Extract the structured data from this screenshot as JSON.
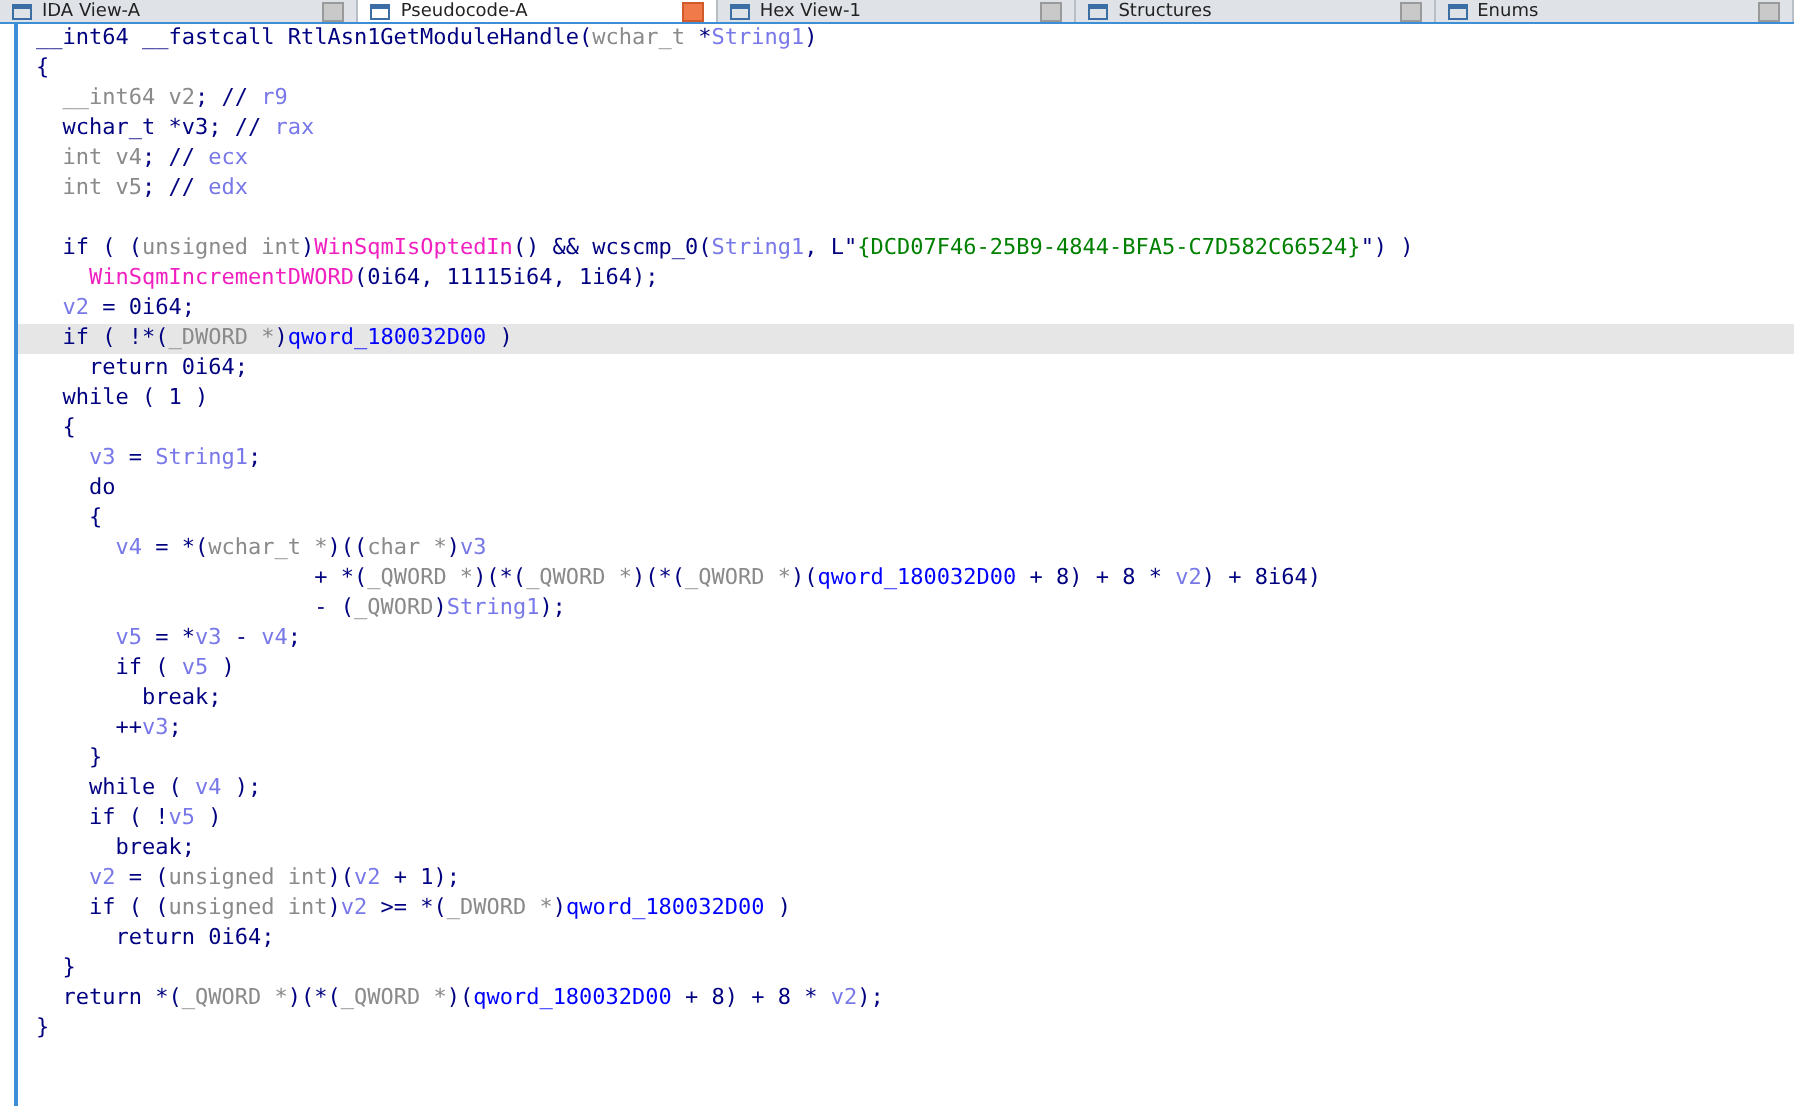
{
  "tabs": [
    {
      "label": "IDA View-A",
      "selected": false
    },
    {
      "label": "Pseudocode-A",
      "selected": true
    },
    {
      "label": "Hex View-1",
      "selected": false
    },
    {
      "label": "Structures",
      "selected": false
    },
    {
      "label": "Enums",
      "selected": false
    }
  ],
  "code": {
    "lines": [
      {
        "selected": false,
        "segments": [
          {
            "kind": "plain",
            "text": "__int64 __fastcall RtlAsn1GetModuleHandle("
          },
          {
            "kind": "type",
            "text": "wchar_t"
          },
          {
            "kind": "plain",
            "text": " *"
          },
          {
            "kind": "var",
            "text": "String1"
          },
          {
            "kind": "plain",
            "text": ")"
          }
        ]
      },
      {
        "selected": false,
        "segments": [
          {
            "kind": "plain",
            "text": "{"
          }
        ]
      },
      {
        "selected": false,
        "segments": [
          {
            "kind": "type",
            "text": "  __int64 v2"
          },
          {
            "kind": "plain",
            "text": "; // "
          },
          {
            "kind": "var",
            "text": "r9"
          }
        ]
      },
      {
        "selected": false,
        "segments": [
          {
            "kind": "plain",
            "text": "  wchar_t *v3; // "
          },
          {
            "kind": "var",
            "text": "rax"
          }
        ]
      },
      {
        "selected": false,
        "segments": [
          {
            "kind": "type",
            "text": "  int v4"
          },
          {
            "kind": "plain",
            "text": "; // "
          },
          {
            "kind": "var",
            "text": "ecx"
          }
        ]
      },
      {
        "selected": false,
        "segments": [
          {
            "kind": "type",
            "text": "  int v5"
          },
          {
            "kind": "plain",
            "text": "; // "
          },
          {
            "kind": "var",
            "text": "edx"
          }
        ]
      },
      {
        "selected": false
      },
      {
        "selected": false,
        "segments": [
          {
            "kind": "plain",
            "text": "  if ( ("
          },
          {
            "kind": "type",
            "text": "unsigned int"
          },
          {
            "kind": "plain",
            "text": ")"
          },
          {
            "kind": "func",
            "text": "WinSqmIsOptedIn"
          },
          {
            "kind": "plain",
            "text": "() && wcscmp_0("
          },
          {
            "kind": "var",
            "text": "String1"
          },
          {
            "kind": "plain",
            "text": ", L\""
          },
          {
            "kind": "string",
            "text": "{DCD07F46-25B9-4844-BFA5-C7D582C66524}"
          },
          {
            "kind": "plain",
            "text": "\") )"
          }
        ]
      },
      {
        "selected": false,
        "segments": [
          {
            "kind": "func",
            "text": "    WinSqmIncrementDWORD"
          },
          {
            "kind": "plain",
            "text": "(0i64, 11115i64, 1i64);"
          }
        ]
      },
      {
        "selected": false,
        "segments": [
          {
            "kind": "var",
            "text": "  v2"
          },
          {
            "kind": "plain",
            "text": " = 0i64;"
          }
        ]
      },
      {
        "selected": true,
        "segments": [
          {
            "kind": "plain",
            "text": "  if ( !*("
          },
          {
            "kind": "type",
            "text": "_DWORD *"
          },
          {
            "kind": "plain",
            "text": ")"
          },
          {
            "kind": "global",
            "text": "qword_180032D00"
          },
          {
            "kind": "plain",
            "text": " )"
          }
        ]
      },
      {
        "selected": false,
        "segments": [
          {
            "kind": "plain",
            "text": "    return 0i64;"
          }
        ]
      },
      {
        "selected": false,
        "segments": [
          {
            "kind": "plain",
            "text": "  while ( 1 )"
          }
        ]
      },
      {
        "selected": false,
        "segments": [
          {
            "kind": "plain",
            "text": "  {"
          }
        ]
      },
      {
        "selected": false,
        "segments": [
          {
            "kind": "var",
            "text": "    v3"
          },
          {
            "kind": "plain",
            "text": " = "
          },
          {
            "kind": "var",
            "text": "String1"
          },
          {
            "kind": "plain",
            "text": ";"
          }
        ]
      },
      {
        "selected": false,
        "segments": [
          {
            "kind": "plain",
            "text": "    do"
          }
        ]
      },
      {
        "selected": false,
        "segments": [
          {
            "kind": "plain",
            "text": "    {"
          }
        ]
      },
      {
        "selected": false,
        "segments": [
          {
            "kind": "var",
            "text": "      v4"
          },
          {
            "kind": "plain",
            "text": " = *("
          },
          {
            "kind": "type",
            "text": "wchar_t *"
          },
          {
            "kind": "plain",
            "text": ")(("
          },
          {
            "kind": "type",
            "text": "char *"
          },
          {
            "kind": "plain",
            "text": ")"
          },
          {
            "kind": "var",
            "text": "v3"
          }
        ]
      },
      {
        "selected": false,
        "segments": [
          {
            "kind": "plain",
            "text": "                     + *("
          },
          {
            "kind": "type",
            "text": "_QWORD *"
          },
          {
            "kind": "plain",
            "text": ")(*("
          },
          {
            "kind": "type",
            "text": "_QWORD *"
          },
          {
            "kind": "plain",
            "text": ")(*("
          },
          {
            "kind": "type",
            "text": "_QWORD *"
          },
          {
            "kind": "plain",
            "text": ")("
          },
          {
            "kind": "global",
            "text": "qword_180032D00"
          },
          {
            "kind": "plain",
            "text": " + 8) + 8 * "
          },
          {
            "kind": "var",
            "text": "v2"
          },
          {
            "kind": "plain",
            "text": ") + 8i64)"
          }
        ]
      },
      {
        "selected": false,
        "segments": [
          {
            "kind": "plain",
            "text": "                     - ("
          },
          {
            "kind": "type",
            "text": "_QWORD"
          },
          {
            "kind": "plain",
            "text": ")"
          },
          {
            "kind": "var",
            "text": "String1"
          },
          {
            "kind": "plain",
            "text": ");"
          }
        ]
      },
      {
        "selected": false,
        "segments": [
          {
            "kind": "var",
            "text": "      v5"
          },
          {
            "kind": "plain",
            "text": " = *"
          },
          {
            "kind": "var",
            "text": "v3"
          },
          {
            "kind": "plain",
            "text": " - "
          },
          {
            "kind": "var",
            "text": "v4"
          },
          {
            "kind": "plain",
            "text": ";"
          }
        ]
      },
      {
        "selected": false,
        "segments": [
          {
            "kind": "plain",
            "text": "      if ( "
          },
          {
            "kind": "var",
            "text": "v5"
          },
          {
            "kind": "plain",
            "text": " )"
          }
        ]
      },
      {
        "selected": false,
        "segments": [
          {
            "kind": "plain",
            "text": "        break;"
          }
        ]
      },
      {
        "selected": false,
        "segments": [
          {
            "kind": "plain",
            "text": "      ++"
          },
          {
            "kind": "var",
            "text": "v3"
          },
          {
            "kind": "plain",
            "text": ";"
          }
        ]
      },
      {
        "selected": false,
        "segments": [
          {
            "kind": "plain",
            "text": "    }"
          }
        ]
      },
      {
        "selected": false,
        "segments": [
          {
            "kind": "plain",
            "text": "    while ( "
          },
          {
            "kind": "var",
            "text": "v4"
          },
          {
            "kind": "plain",
            "text": " );"
          }
        ]
      },
      {
        "selected": false,
        "segments": [
          {
            "kind": "plain",
            "text": "    if ( !"
          },
          {
            "kind": "var",
            "text": "v5"
          },
          {
            "kind": "plain",
            "text": " )"
          }
        ]
      },
      {
        "selected": false,
        "segments": [
          {
            "kind": "plain",
            "text": "      break;"
          }
        ]
      },
      {
        "selected": false,
        "segments": [
          {
            "kind": "var",
            "text": "    v2"
          },
          {
            "kind": "plain",
            "text": " = ("
          },
          {
            "kind": "type",
            "text": "unsigned int"
          },
          {
            "kind": "plain",
            "text": ")("
          },
          {
            "kind": "var",
            "text": "v2"
          },
          {
            "kind": "plain",
            "text": " + 1);"
          }
        ]
      },
      {
        "selected": false,
        "segments": [
          {
            "kind": "plain",
            "text": "    if ( ("
          },
          {
            "kind": "type",
            "text": "unsigned int"
          },
          {
            "kind": "plain",
            "text": ")"
          },
          {
            "kind": "var",
            "text": "v2"
          },
          {
            "kind": "plain",
            "text": " >= *("
          },
          {
            "kind": "type",
            "text": "_DWORD *"
          },
          {
            "kind": "plain",
            "text": ")"
          },
          {
            "kind": "global",
            "text": "qword_180032D00"
          },
          {
            "kind": "plain",
            "text": " )"
          }
        ]
      },
      {
        "selected": false,
        "segments": [
          {
            "kind": "plain",
            "text": "      return 0i64;"
          }
        ]
      },
      {
        "selected": false,
        "segments": [
          {
            "kind": "plain",
            "text": "  }"
          }
        ]
      },
      {
        "selected": false,
        "segments": [
          {
            "kind": "plain",
            "text": "  return *("
          },
          {
            "kind": "type",
            "text": "_QWORD *"
          },
          {
            "kind": "plain",
            "text": ")(*("
          },
          {
            "kind": "type",
            "text": "_QWORD *"
          },
          {
            "kind": "plain",
            "text": ")("
          },
          {
            "kind": "global",
            "text": "qword_180032D00"
          },
          {
            "kind": "plain",
            "text": " + 8) + 8 * "
          },
          {
            "kind": "var",
            "text": "v2"
          },
          {
            "kind": "plain",
            "text": ");"
          }
        ]
      },
      {
        "selected": false,
        "segments": [
          {
            "kind": "plain",
            "text": "}"
          }
        ]
      }
    ]
  }
}
